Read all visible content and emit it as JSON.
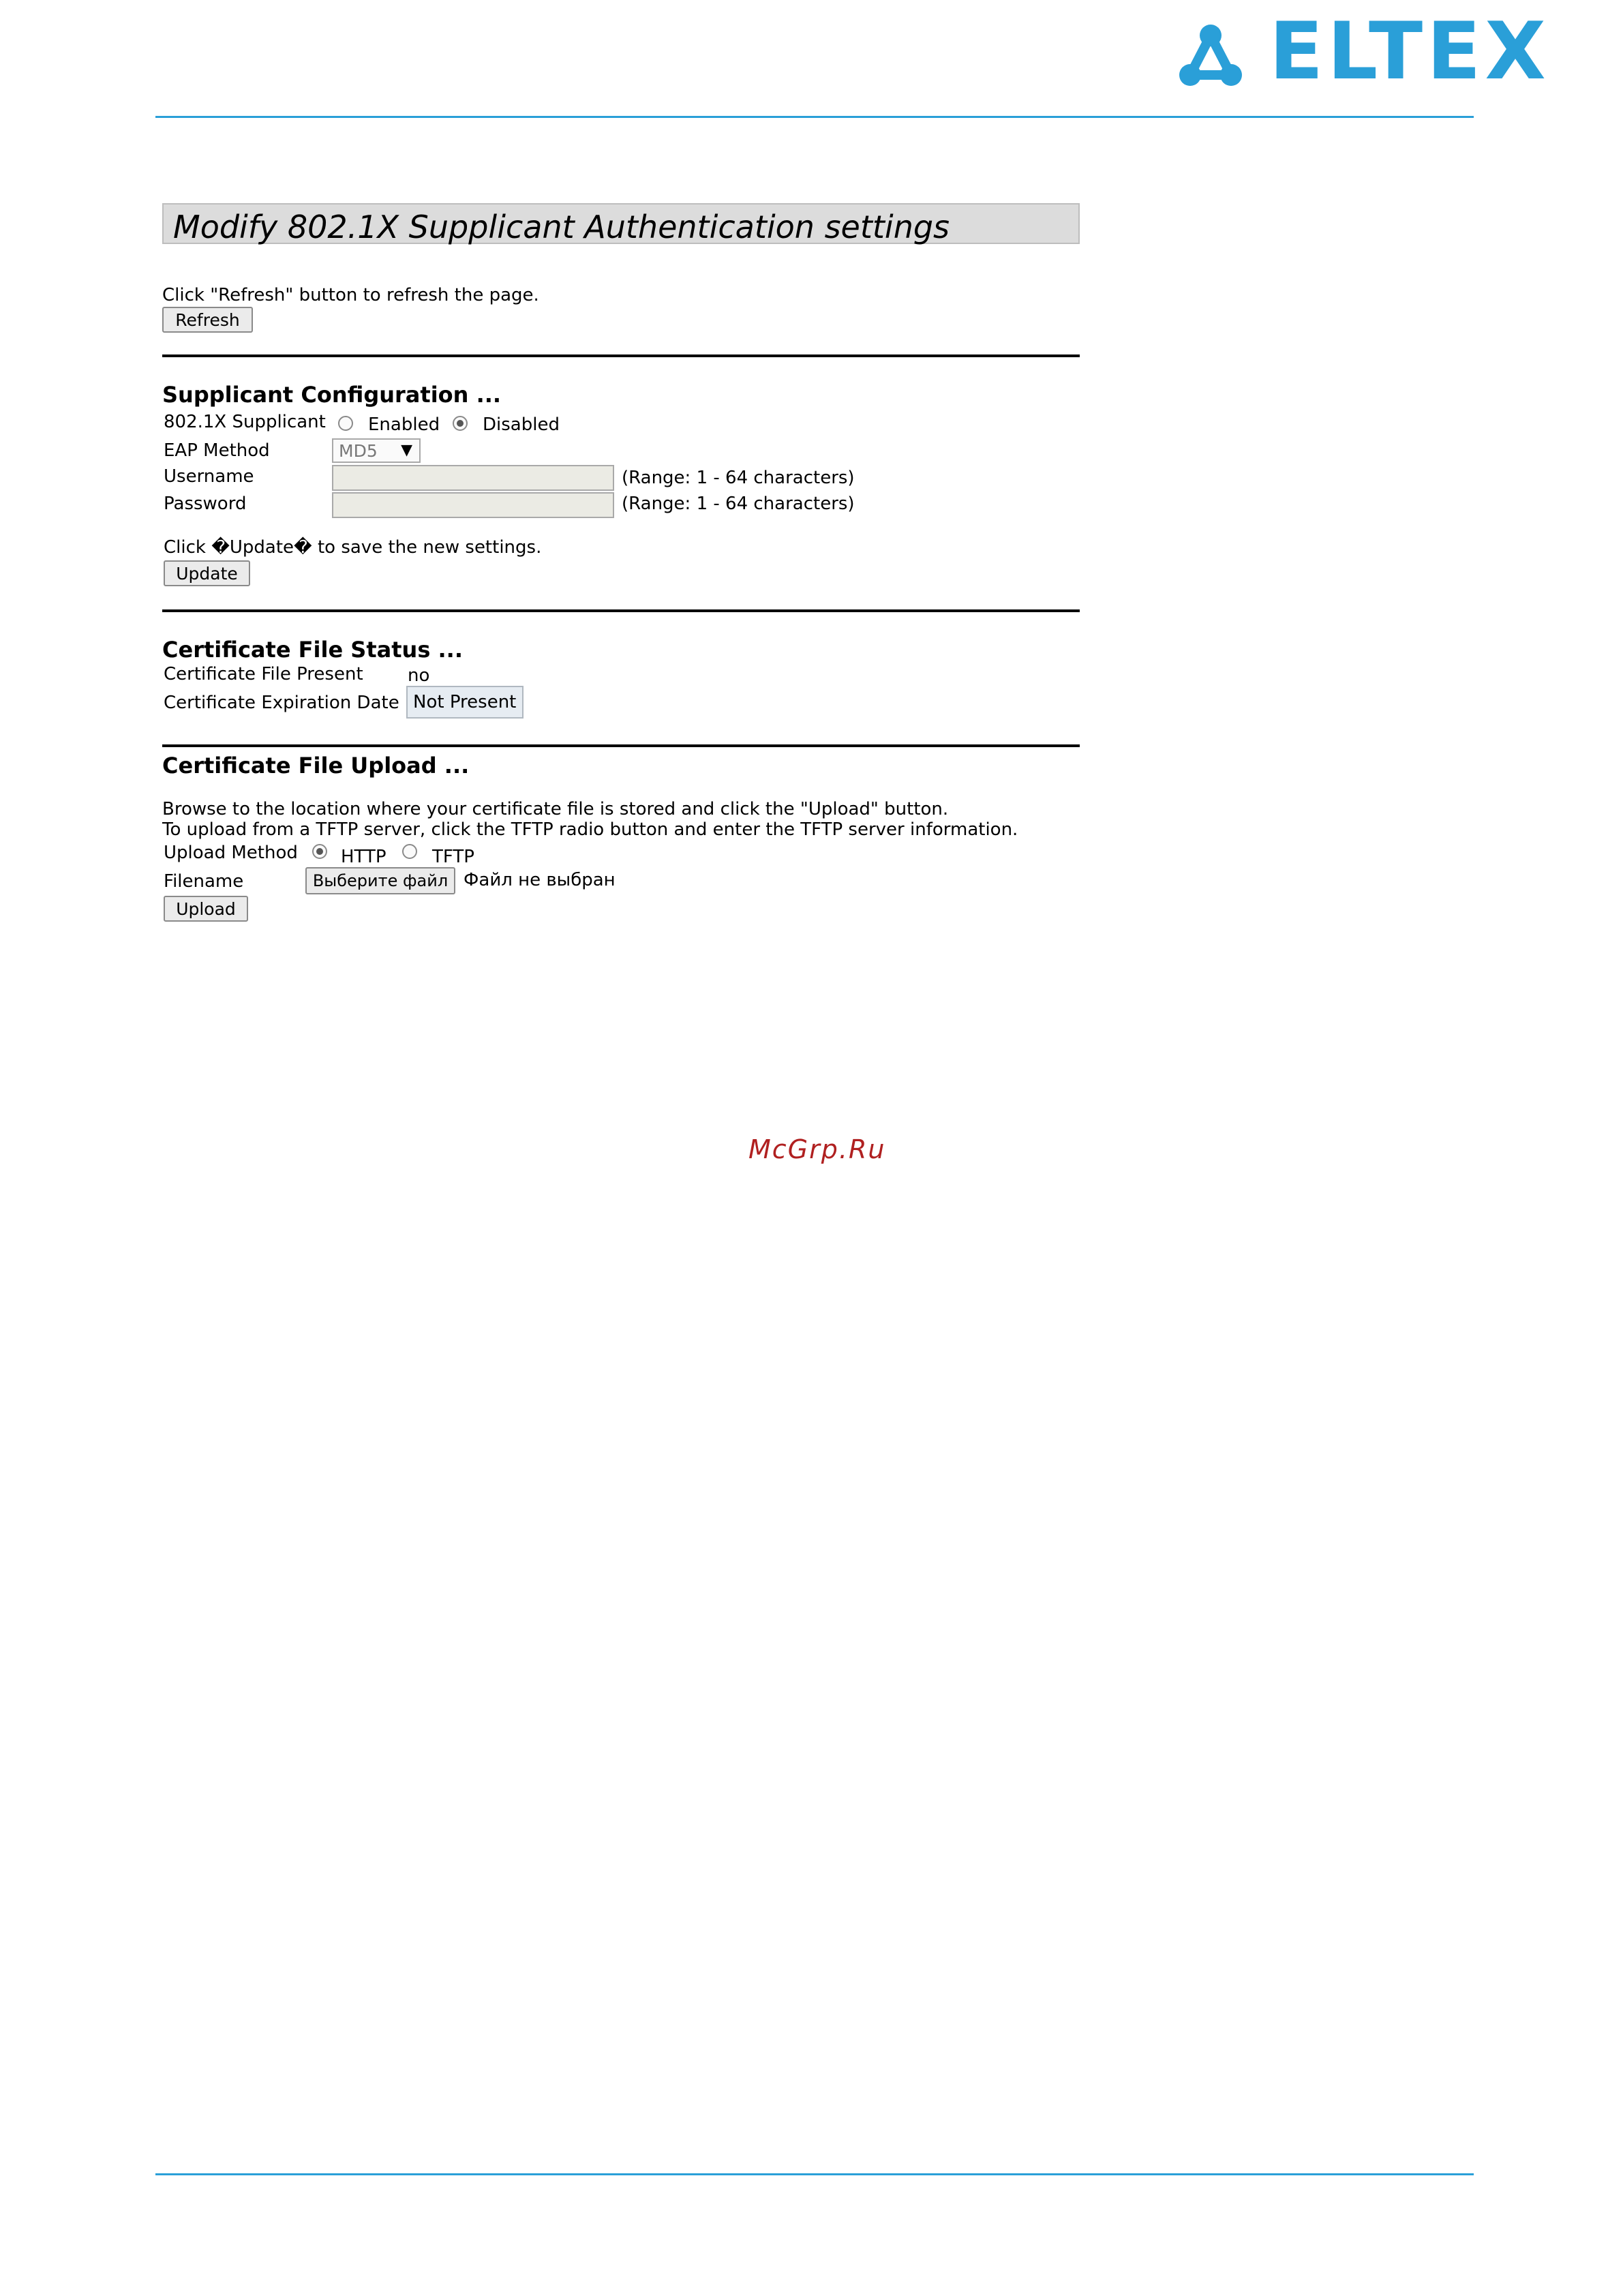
{
  "brand": {
    "logo_text": "ELTEX",
    "accent_color": "#2a9fd8"
  },
  "page_title": "Modify 802.1X Supplicant Authentication settings",
  "refresh": {
    "hint": "Click \"Refresh\" button to refresh the page.",
    "button": "Refresh"
  },
  "supplicant": {
    "heading": "Supplicant Configuration ...",
    "supplicant_label": "802.1X Supplicant",
    "enabled_label": "Enabled",
    "disabled_label": "Disabled",
    "selected": "Disabled",
    "eap_label": "EAP Method",
    "eap_value": "MD5",
    "username_label": "Username",
    "username_value": "",
    "username_range": "(Range: 1 - 64 characters)",
    "password_label": "Password",
    "password_value": "",
    "password_range": "(Range: 1 - 64 characters)",
    "update_hint": "Click �Update� to save the new settings.",
    "update_button": "Update"
  },
  "cert_status": {
    "heading": "Certificate File Status ...",
    "present_label": "Certificate File Present",
    "present_value": "no",
    "expiration_label": "Certificate Expiration Date",
    "expiration_value": "Not Present"
  },
  "cert_upload": {
    "heading": "Certificate File Upload ...",
    "instruction_1": "Browse to the location where your certificate file is stored and click the \"Upload\" button.",
    "instruction_2": "To upload from a TFTP server, click the TFTP radio button and enter the TFTP server information.",
    "method_label": "Upload Method",
    "http_label": "HTTP",
    "tftp_label": "TFTP",
    "selected": "HTTP",
    "filename_label": "Filename",
    "choose_button": "Выберите файл",
    "no_file_text": "Файл не выбран",
    "upload_button": "Upload"
  },
  "watermark": "McGrp.Ru"
}
